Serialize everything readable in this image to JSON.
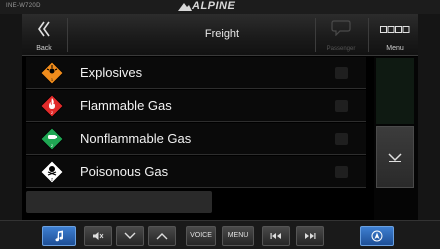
{
  "device": {
    "model": "INE-W720D",
    "brand": "ALPINE"
  },
  "header": {
    "back_label": "Back",
    "title": "Freight",
    "chat_label": "Passenger",
    "menu_label": "Menu"
  },
  "list": {
    "items": [
      {
        "label": "Explosives",
        "icon": "explosives-hazard-icon",
        "color": "#f08c1c"
      },
      {
        "label": "Flammable Gas",
        "icon": "flammable-gas-hazard-icon",
        "color": "#e22b2b"
      },
      {
        "label": "Nonflammable Gas",
        "icon": "nonflammable-gas-hazard-icon",
        "color": "#1fa653"
      },
      {
        "label": "Poisonous Gas",
        "icon": "poisonous-gas-hazard-icon",
        "color": "#ffffff"
      }
    ]
  },
  "hardware": {
    "voice_label": "VOICE",
    "menu_label": "MENU"
  }
}
